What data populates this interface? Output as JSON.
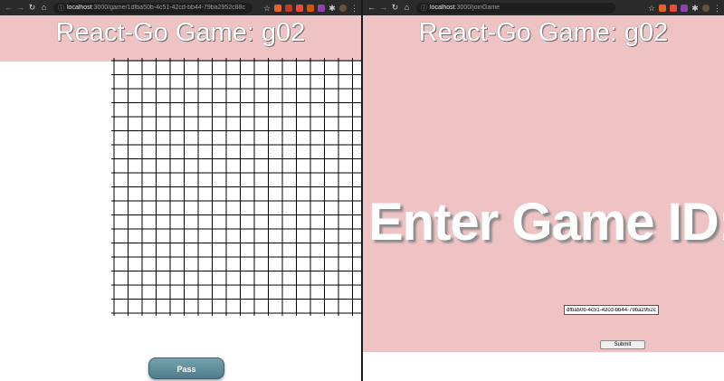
{
  "left_window": {
    "url_host": "localhost",
    "url_path": ":3000/game/1dfba50b-4c51-42cd-bb44-79ba2952c88c",
    "title": "React-Go Game: g02",
    "pass_label": "Pass"
  },
  "right_window": {
    "url_host": "localhost",
    "url_path": ":3000/joinGame",
    "title": "React-Go Game: g02",
    "heading": "Enter Game ID:",
    "game_id_value": "dfba50b-4c51-42cd-bb44-79ba2952c88c",
    "submit_label": "Submit"
  },
  "board": {
    "columns": 19,
    "rows": 19
  },
  "colors": {
    "banner": "#efc2c3",
    "pass_button": "#5f8f9b",
    "grid": "#000000"
  }
}
